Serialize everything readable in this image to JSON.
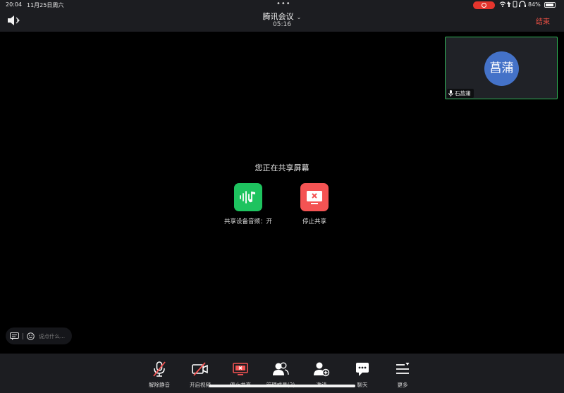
{
  "status_bar": {
    "time": "20:04",
    "date": "11月25日周六",
    "battery": "84%"
  },
  "header": {
    "title": "腾讯会议",
    "elapsed": "05:16",
    "end_label": "结束"
  },
  "participant": {
    "avatar_text": "菖蒲",
    "name": "石菖蒲",
    "avatar_color": "#4472c8"
  },
  "share": {
    "title": "您正在共享屏幕",
    "audio_label": "共享设备音频：开",
    "stop_label": "停止共享"
  },
  "chat": {
    "placeholder": "说点什么..."
  },
  "toolbar": {
    "items": [
      {
        "label": "解除静音",
        "icon": "mic-muted-icon"
      },
      {
        "label": "开启视频",
        "icon": "video-off-icon"
      },
      {
        "label": "停止共享",
        "icon": "stop-share-icon"
      },
      {
        "label": "管理成员(2)",
        "icon": "members-icon"
      },
      {
        "label": "邀请",
        "icon": "invite-icon"
      },
      {
        "label": "聊天",
        "icon": "chat-icon"
      },
      {
        "label": "更多",
        "icon": "more-icon"
      }
    ]
  },
  "colors": {
    "accent_green": "#1ec35f",
    "danger_red": "#f45353",
    "end_red": "#f05145",
    "active_border": "#2fb456"
  }
}
